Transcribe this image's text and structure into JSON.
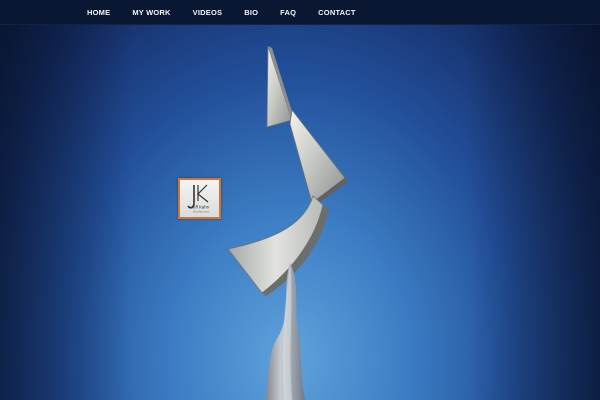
{
  "nav": {
    "items": [
      {
        "label": "HOME"
      },
      {
        "label": "MY WORK"
      },
      {
        "label": "VIDEOS"
      },
      {
        "label": "BIO"
      },
      {
        "label": "FAQ"
      },
      {
        "label": "CONTACT"
      }
    ]
  },
  "logo": {
    "monogram": "JK",
    "name": "Jeff Kahn",
    "subtitle": "Sculpture",
    "border_color": "#d4752b"
  },
  "colors": {
    "topbar": "#0a1733",
    "sky_center": "#5fa3dc",
    "sky_edge": "#0b1a3d",
    "nav_text": "#f2f5fa"
  }
}
